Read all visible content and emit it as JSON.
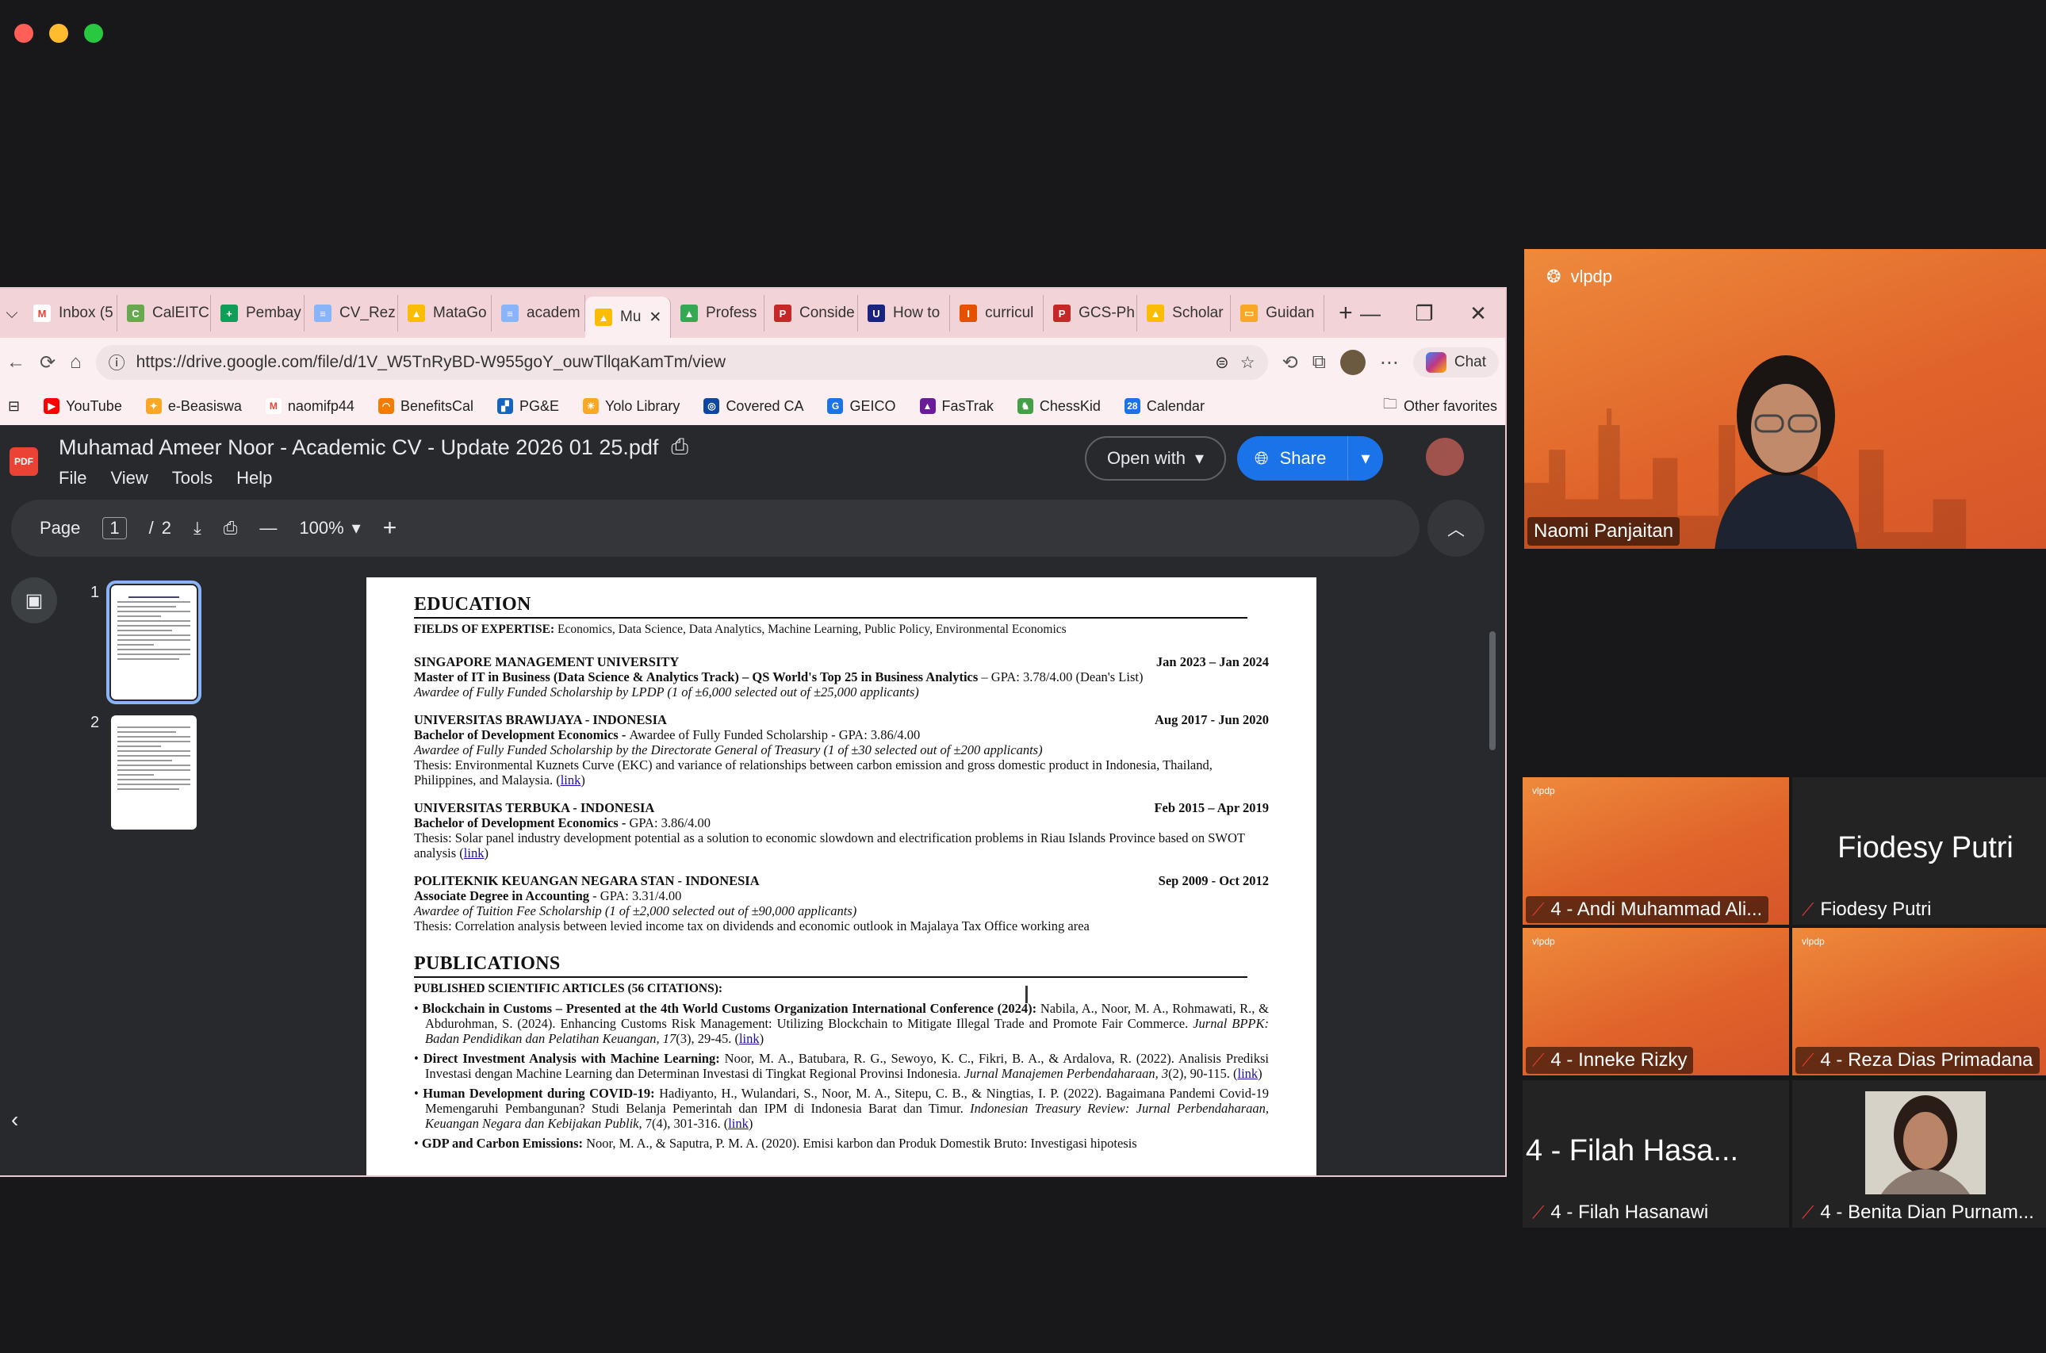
{
  "browser": {
    "tabs": [
      "Inbox (5",
      "CalEITC",
      "Pembay",
      "CV_Rez",
      "MataGo",
      "academ",
      "Mu",
      "Profess",
      "Conside",
      "How to",
      "curricul",
      "GCS-Ph",
      "Scholar",
      "Guidan"
    ],
    "active_tab_index": 6,
    "url": "https://drive.google.com/file/d/1V_W5TnRyBD-W955goY_ouwTllqaKamTm/view",
    "chat_label": "Chat",
    "bookmarks": [
      "YouTube",
      "e-Beasiswa",
      "naomifp44",
      "BenefitsCal",
      "PG&E",
      "Yolo Library",
      "Covered CA",
      "GEICO",
      "FasTrak",
      "ChessKid",
      "Calendar"
    ],
    "other_favorites": "Other favorites"
  },
  "viewer": {
    "pdf_badge": "PDF",
    "title": "Muhamad Ameer Noor - Academic CV - Update 2026 01 25.pdf",
    "menus": [
      "File",
      "View",
      "Tools",
      "Help"
    ],
    "open_with": "Open with",
    "share": "Share",
    "page_label": "Page",
    "page_current": "1",
    "page_sep": "/",
    "page_total": "2",
    "zoom": "100%",
    "thumbs": [
      "1",
      "2"
    ]
  },
  "cv": {
    "education_heading": "EDUCATION",
    "fields_label": "FIELDS OF EXPERTISE:",
    "fields": "Economics, Data Science, Data Analytics, Machine Learning, Public Policy, Environmental Economics",
    "education": [
      {
        "school": "SINGAPORE MANAGEMENT UNIVERSITY",
        "dates": "Jan 2023 – Jan 2024",
        "degree": "Master of IT in Business (Data Science & Analytics Track) – QS World's Top 25 in Business Analytics",
        "degree_rest": " – GPA: 3.78/4.00 (Dean's List)",
        "lines": [
          {
            "t": "Awardee of Fully Funded Scholarship by LPDP (1 of ±6,000 selected out of ±25,000 applicants)",
            "it": true
          }
        ]
      },
      {
        "school": "UNIVERSITAS BRAWIJAYA - INDONESIA",
        "dates": "Aug 2017 - Jun 2020",
        "degree": "Bachelor of Development Economics - ",
        "degree_rest": "Awardee of Fully Funded Scholarship - GPA: 3.86/4.00",
        "lines": [
          {
            "t": "Awardee of Fully Funded Scholarship by the Directorate General of Treasury (1 of ±30 selected out of ±200 applicants)",
            "it": true
          },
          {
            "t": "Thesis: Environmental Kuznets Curve (EKC) and variance of relationships between carbon emission and gross domestic product in Indonesia, Thailand, Philippines, and Malaysia. (",
            "link": "link",
            "after": ")"
          }
        ]
      },
      {
        "school": "UNIVERSITAS TERBUKA - INDONESIA",
        "dates": "Feb 2015 – Apr 2019",
        "degree": "Bachelor of Development Economics - ",
        "degree_rest": "GPA: 3.86/4.00",
        "lines": [
          {
            "t": "Thesis: Solar panel industry development potential as a solution to economic slowdown and electrification problems in Riau Islands Province based on SWOT analysis (",
            "link": "link",
            "after": ")"
          }
        ]
      },
      {
        "school": "POLITEKNIK KEUANGAN NEGARA STAN - INDONESIA",
        "dates": "Sep 2009 - Oct 2012",
        "degree": "Associate Degree in Accounting",
        "degree_rest": " - GPA: 3.31/4.00",
        "lines": [
          {
            "t": "Awardee of Tuition Fee Scholarship (1 of ±2,000 selected out of ±90,000 applicants)",
            "it": true
          },
          {
            "t": "Thesis: Correlation analysis between levied income tax on dividends and economic outlook in Majalaya Tax Office working area"
          }
        ]
      }
    ],
    "publications_heading": "PUBLICATIONS",
    "published_label": "PUBLISHED SCIENTIFIC ARTICLES (56 CITATIONS):",
    "pubs": [
      {
        "title": "Blockchain in Customs – Presented at the 4th World Customs Organization International Conference (2024):",
        "body": " Nabila, A., Noor, M. A., Rohmawati, R., & Abdurohman, S. (2024). Enhancing Customs Risk Management: Utilizing Blockchain to Mitigate Illegal Trade and Promote Fair Commerce. ",
        "journal": "Jurnal BPPK: Badan Pendidikan dan Pelatihan Keuangan, 17",
        "tail": "(3), 29-45. (",
        "link": "link",
        "after": ")"
      },
      {
        "title": "Direct Investment Analysis with Machine Learning:",
        "body": " Noor, M. A., Batubara, R. G., Sewoyo, K. C., Fikri, B. A., & Ardalova, R. (2022). Analisis Prediksi Investasi dengan Machine Learning dan Determinan Investasi di Tingkat Regional Provinsi Indonesia. ",
        "journal": "Jurnal Manajemen Perbendaharaan, 3",
        "tail": "(2), 90-115. (",
        "link": "link",
        "after": ")"
      },
      {
        "title": "Human Development during COVID-19:",
        "body": " Hadiyanto, H., Wulandari, S., Noor, M. A., Sitepu, C. B., & Ningtias, I. P. (2022). Bagaimana Pandemi Covid-19 Memengaruhi Pembangunan? Studi Belanja Pemerintah dan IPM di Indonesia Barat dan Timur. ",
        "journal": "Indonesian Treasury Review: Jurnal Perbendaharaan, Keuangan Negara dan Kebijakan Publik",
        "tail": ", 7(4), 301-316. (",
        "link": "link",
        "after": ")"
      },
      {
        "title": "GDP and Carbon Emissions:",
        "body": " Noor, M. A., & Saputra, P. M. A. (2020). Emisi karbon dan Produk Domestik Bruto: Investigasi hipotesis",
        "journal": "",
        "tail": "",
        "link": "",
        "after": ""
      }
    ]
  },
  "meeting": {
    "main": {
      "name": "Naomi Panjaitan",
      "logo": "vlpdp"
    },
    "tiles": [
      {
        "name": "4 - Andi Muhammad Ali...",
        "style": "orange",
        "big": ""
      },
      {
        "name": "Fiodesy Putri",
        "style": "dark",
        "big": "Fiodesy Putri"
      },
      {
        "name": "4 - Inneke Rizky",
        "style": "orange",
        "big": ""
      },
      {
        "name": "4 - Reza Dias Primadana",
        "style": "orange",
        "big": ""
      },
      {
        "name": "4 - Filah Hasanawi",
        "style": "dark",
        "big": "4 - Filah Hasa..."
      },
      {
        "name": "4 - Benita Dian Purnam...",
        "style": "dark",
        "big": ""
      }
    ],
    "tile_logo": "vlpdp"
  }
}
